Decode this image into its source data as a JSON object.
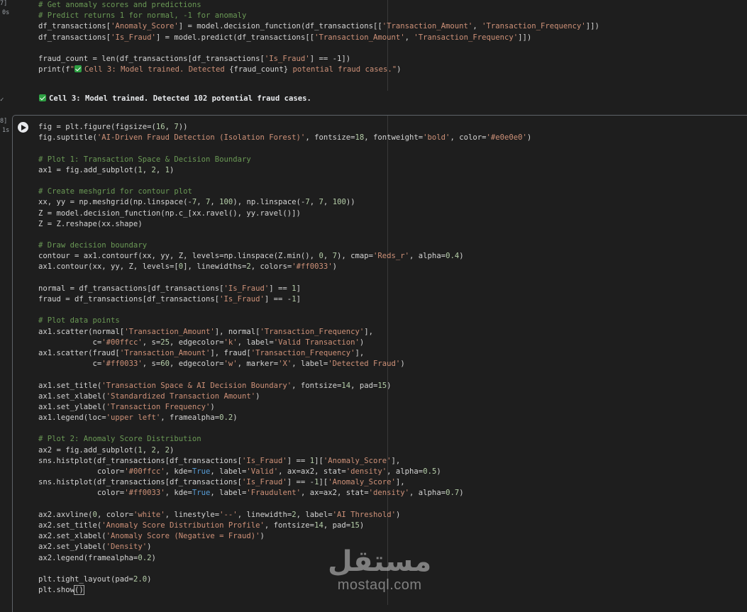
{
  "cell1": {
    "exec_count": "7]",
    "exec_time": "0s",
    "lines": [
      {
        "comment": "# Get anomaly scores and predictions"
      },
      {
        "comment": "# Predict returns 1 for normal, -1 for anomaly"
      },
      {
        "parts": [
          [
            "t",
            "df_transactions["
          ],
          [
            "s",
            "'Anomaly_Score'"
          ],
          [
            "t",
            "] = model.decision_function(df_transactions[["
          ],
          [
            "s",
            "'Transaction_Amount'"
          ],
          [
            "t",
            ", "
          ],
          [
            "s",
            "'Transaction_Frequency'"
          ],
          [
            "t",
            "]])"
          ]
        ]
      },
      {
        "parts": [
          [
            "t",
            "df_transactions["
          ],
          [
            "s",
            "'Is_Fraud'"
          ],
          [
            "t",
            "] = model.predict(df_transactions[["
          ],
          [
            "s",
            "'Transaction_Amount'"
          ],
          [
            "t",
            ", "
          ],
          [
            "s",
            "'Transaction_Frequency'"
          ],
          [
            "t",
            "]])"
          ]
        ]
      },
      {
        "blank": true
      },
      {
        "parts": [
          [
            "t",
            "fraud_count = len(df_transactions[df_transactions["
          ],
          [
            "s",
            "'Is_Fraud'"
          ],
          [
            "t",
            "] == -1])"
          ]
        ]
      },
      {
        "parts": [
          [
            "t",
            "print(f"
          ],
          [
            "s",
            "\""
          ],
          [
            "ok",
            ""
          ],
          [
            "s",
            "Cell 3: Model trained. Detected "
          ],
          [
            "t",
            "{fraud_count}"
          ],
          [
            "s",
            " potential fraud cases.\""
          ],
          [
            "t",
            ")"
          ]
        ]
      }
    ],
    "output": "Cell 3: Model trained. Detected 102 potential fraud cases."
  },
  "cell2": {
    "exec_count": "8]",
    "exec_time": "1s",
    "lines": [
      {
        "parts": [
          [
            "t",
            "fig = plt.figure(figsize=("
          ],
          [
            "n",
            "16"
          ],
          [
            "t",
            ", "
          ],
          [
            "n",
            "7"
          ],
          [
            "t",
            "))"
          ]
        ]
      },
      {
        "parts": [
          [
            "t",
            "fig.suptitle("
          ],
          [
            "s",
            "'AI-Driven Fraud Detection (Isolation Forest)'"
          ],
          [
            "t",
            ", fontsize="
          ],
          [
            "n",
            "18"
          ],
          [
            "t",
            ", fontweight="
          ],
          [
            "s",
            "'bold'"
          ],
          [
            "t",
            ", color="
          ],
          [
            "s",
            "'#e0e0e0'"
          ],
          [
            "t",
            ")"
          ]
        ]
      },
      {
        "blank": true
      },
      {
        "comment": "# Plot 1: Transaction Space & Decision Boundary"
      },
      {
        "parts": [
          [
            "t",
            "ax1 = fig.add_subplot("
          ],
          [
            "n",
            "1"
          ],
          [
            "t",
            ", "
          ],
          [
            "n",
            "2"
          ],
          [
            "t",
            ", "
          ],
          [
            "n",
            "1"
          ],
          [
            "t",
            ")"
          ]
        ]
      },
      {
        "blank": true
      },
      {
        "comment": "# Create meshgrid for contour plot"
      },
      {
        "parts": [
          [
            "t",
            "xx, yy = np.meshgrid(np.linspace(-"
          ],
          [
            "n",
            "7"
          ],
          [
            "t",
            ", "
          ],
          [
            "n",
            "7"
          ],
          [
            "t",
            ", "
          ],
          [
            "n",
            "100"
          ],
          [
            "t",
            "), np.linspace(-"
          ],
          [
            "n",
            "7"
          ],
          [
            "t",
            ", "
          ],
          [
            "n",
            "7"
          ],
          [
            "t",
            ", "
          ],
          [
            "n",
            "100"
          ],
          [
            "t",
            "))"
          ]
        ]
      },
      {
        "parts": [
          [
            "t",
            "Z = model.decision_function(np.c_[xx.ravel(), yy.ravel()])"
          ]
        ]
      },
      {
        "parts": [
          [
            "t",
            "Z = Z.reshape(xx.shape)"
          ]
        ]
      },
      {
        "blank": true
      },
      {
        "comment": "# Draw decision boundary"
      },
      {
        "parts": [
          [
            "t",
            "contour = ax1.contourf(xx, yy, Z, levels=np.linspace(Z.min(), "
          ],
          [
            "n",
            "0"
          ],
          [
            "t",
            ", "
          ],
          [
            "n",
            "7"
          ],
          [
            "t",
            "), cmap="
          ],
          [
            "s",
            "'Reds_r'"
          ],
          [
            "t",
            ", alpha="
          ],
          [
            "n",
            "0.4"
          ],
          [
            "t",
            ")"
          ]
        ]
      },
      {
        "parts": [
          [
            "t",
            "ax1.contour(xx, yy, Z, levels=["
          ],
          [
            "n",
            "0"
          ],
          [
            "t",
            "], linewidths="
          ],
          [
            "n",
            "2"
          ],
          [
            "t",
            ", colors="
          ],
          [
            "s",
            "'#ff0033'"
          ],
          [
            "t",
            ")"
          ]
        ]
      },
      {
        "blank": true
      },
      {
        "parts": [
          [
            "t",
            "normal = df_transactions[df_transactions["
          ],
          [
            "s",
            "'Is_Fraud'"
          ],
          [
            "t",
            "] == "
          ],
          [
            "n",
            "1"
          ],
          [
            "t",
            "]"
          ]
        ]
      },
      {
        "parts": [
          [
            "t",
            "fraud = df_transactions[df_transactions["
          ],
          [
            "s",
            "'Is_Fraud'"
          ],
          [
            "t",
            "] == -"
          ],
          [
            "n",
            "1"
          ],
          [
            "t",
            "]"
          ]
        ]
      },
      {
        "blank": true
      },
      {
        "comment": "# Plot data points"
      },
      {
        "parts": [
          [
            "t",
            "ax1.scatter(normal["
          ],
          [
            "s",
            "'Transaction_Amount'"
          ],
          [
            "t",
            "], normal["
          ],
          [
            "s",
            "'Transaction_Frequency'"
          ],
          [
            "t",
            "],"
          ]
        ]
      },
      {
        "parts": [
          [
            "t",
            "            c="
          ],
          [
            "s",
            "'#00ffcc'"
          ],
          [
            "t",
            ", s="
          ],
          [
            "n",
            "25"
          ],
          [
            "t",
            ", edgecolor="
          ],
          [
            "s",
            "'k'"
          ],
          [
            "t",
            ", label="
          ],
          [
            "s",
            "'Valid Transaction'"
          ],
          [
            "t",
            ")"
          ]
        ]
      },
      {
        "parts": [
          [
            "t",
            "ax1.scatter(fraud["
          ],
          [
            "s",
            "'Transaction_Amount'"
          ],
          [
            "t",
            "], fraud["
          ],
          [
            "s",
            "'Transaction_Frequency'"
          ],
          [
            "t",
            "],"
          ]
        ]
      },
      {
        "parts": [
          [
            "t",
            "            c="
          ],
          [
            "s",
            "'#ff0033'"
          ],
          [
            "t",
            ", s="
          ],
          [
            "n",
            "60"
          ],
          [
            "t",
            ", edgecolor="
          ],
          [
            "s",
            "'w'"
          ],
          [
            "t",
            ", marker="
          ],
          [
            "s",
            "'X'"
          ],
          [
            "t",
            ", label="
          ],
          [
            "s",
            "'Detected Fraud'"
          ],
          [
            "t",
            ")"
          ]
        ]
      },
      {
        "blank": true
      },
      {
        "parts": [
          [
            "t",
            "ax1.set_title("
          ],
          [
            "s",
            "'Transaction Space & AI Decision Boundary'"
          ],
          [
            "t",
            ", fontsize="
          ],
          [
            "n",
            "14"
          ],
          [
            "t",
            ", pad="
          ],
          [
            "n",
            "15"
          ],
          [
            "t",
            ")"
          ]
        ]
      },
      {
        "parts": [
          [
            "t",
            "ax1.set_xlabel("
          ],
          [
            "s",
            "'Standardized Transaction Amount'"
          ],
          [
            "t",
            ")"
          ]
        ]
      },
      {
        "parts": [
          [
            "t",
            "ax1.set_ylabel("
          ],
          [
            "s",
            "'Transaction Frequency'"
          ],
          [
            "t",
            ")"
          ]
        ]
      },
      {
        "parts": [
          [
            "t",
            "ax1.legend(loc="
          ],
          [
            "s",
            "'upper left'"
          ],
          [
            "t",
            ", framealpha="
          ],
          [
            "n",
            "0.2"
          ],
          [
            "t",
            ")"
          ]
        ]
      },
      {
        "blank": true
      },
      {
        "comment": "# Plot 2: Anomaly Score Distribution"
      },
      {
        "parts": [
          [
            "t",
            "ax2 = fig.add_subplot("
          ],
          [
            "n",
            "1"
          ],
          [
            "t",
            ", "
          ],
          [
            "n",
            "2"
          ],
          [
            "t",
            ", "
          ],
          [
            "n",
            "2"
          ],
          [
            "t",
            ")"
          ]
        ]
      },
      {
        "parts": [
          [
            "t",
            "sns.histplot(df_transactions[df_transactions["
          ],
          [
            "s",
            "'Is_Fraud'"
          ],
          [
            "t",
            "] == "
          ],
          [
            "n",
            "1"
          ],
          [
            "t",
            "]["
          ],
          [
            "s",
            "'Anomaly_Score'"
          ],
          [
            "t",
            "],"
          ]
        ]
      },
      {
        "parts": [
          [
            "t",
            "             color="
          ],
          [
            "s",
            "'#00ffcc'"
          ],
          [
            "t",
            ", kde="
          ],
          [
            "k",
            "True"
          ],
          [
            "t",
            ", label="
          ],
          [
            "s",
            "'Valid'"
          ],
          [
            "t",
            ", ax=ax2, stat="
          ],
          [
            "s",
            "'density'"
          ],
          [
            "t",
            ", alpha="
          ],
          [
            "n",
            "0.5"
          ],
          [
            "t",
            ")"
          ]
        ]
      },
      {
        "parts": [
          [
            "t",
            "sns.histplot(df_transactions[df_transactions["
          ],
          [
            "s",
            "'Is_Fraud'"
          ],
          [
            "t",
            "] == -"
          ],
          [
            "n",
            "1"
          ],
          [
            "t",
            "]["
          ],
          [
            "s",
            "'Anomaly_Score'"
          ],
          [
            "t",
            "],"
          ]
        ]
      },
      {
        "parts": [
          [
            "t",
            "             color="
          ],
          [
            "s",
            "'#ff0033'"
          ],
          [
            "t",
            ", kde="
          ],
          [
            "k",
            "True"
          ],
          [
            "t",
            ", label="
          ],
          [
            "s",
            "'Fraudulent'"
          ],
          [
            "t",
            ", ax=ax2, stat="
          ],
          [
            "s",
            "'density'"
          ],
          [
            "t",
            ", alpha="
          ],
          [
            "n",
            "0.7"
          ],
          [
            "t",
            ")"
          ]
        ]
      },
      {
        "blank": true
      },
      {
        "parts": [
          [
            "t",
            "ax2.axvline("
          ],
          [
            "n",
            "0"
          ],
          [
            "t",
            ", color="
          ],
          [
            "s",
            "'white'"
          ],
          [
            "t",
            ", linestyle="
          ],
          [
            "s",
            "'--'"
          ],
          [
            "t",
            ", linewidth="
          ],
          [
            "n",
            "2"
          ],
          [
            "t",
            ", label="
          ],
          [
            "s",
            "'AI Threshold'"
          ],
          [
            "t",
            ")"
          ]
        ]
      },
      {
        "parts": [
          [
            "t",
            "ax2.set_title("
          ],
          [
            "s",
            "'Anomaly Score Distribution Profile'"
          ],
          [
            "t",
            ", fontsize="
          ],
          [
            "n",
            "14"
          ],
          [
            "t",
            ", pad="
          ],
          [
            "n",
            "15"
          ],
          [
            "t",
            ")"
          ]
        ]
      },
      {
        "parts": [
          [
            "t",
            "ax2.set_xlabel("
          ],
          [
            "s",
            "'Anomaly Score (Negative = Fraud)'"
          ],
          [
            "t",
            ")"
          ]
        ]
      },
      {
        "parts": [
          [
            "t",
            "ax2.set_ylabel("
          ],
          [
            "s",
            "'Density'"
          ],
          [
            "t",
            ")"
          ]
        ]
      },
      {
        "parts": [
          [
            "t",
            "ax2.legend(framealpha="
          ],
          [
            "n",
            "0.2"
          ],
          [
            "t",
            ")"
          ]
        ]
      },
      {
        "blank": true
      },
      {
        "parts": [
          [
            "t",
            "plt.tight_layout(pad="
          ],
          [
            "n",
            "2.0"
          ],
          [
            "t",
            ")"
          ]
        ]
      },
      {
        "parts": [
          [
            "t",
            "plt.show"
          ],
          [
            "c",
            "()"
          ]
        ]
      }
    ]
  },
  "watermark": {
    "arabic": "مستقل",
    "latin": "mostaql.com"
  },
  "colors": {
    "comment": "#6a9955",
    "string": "#ce9178",
    "number": "#b5cea8",
    "keyword": "#569cd6",
    "background": "#1e1e1e",
    "success": "#2ea043"
  }
}
